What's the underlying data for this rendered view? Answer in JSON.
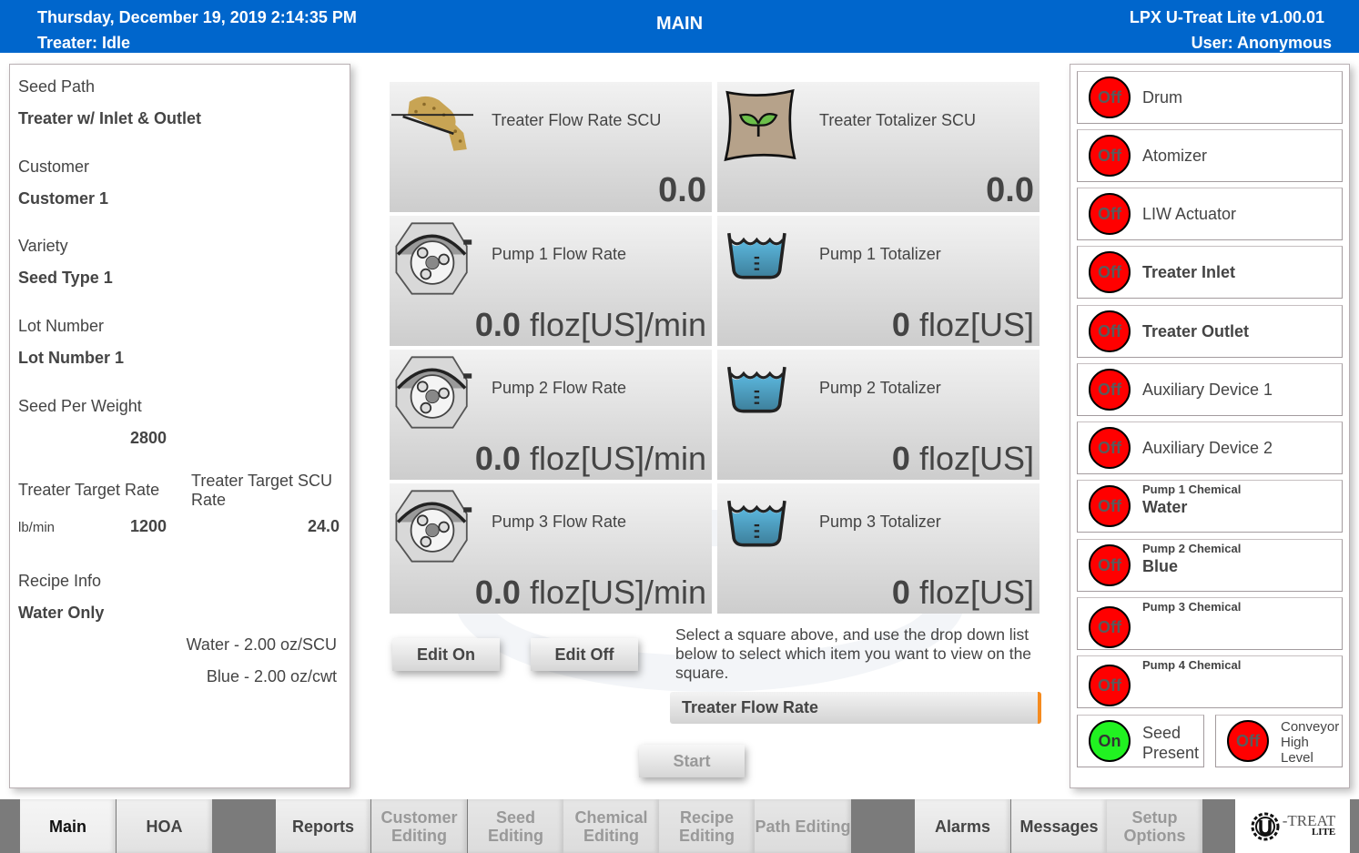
{
  "header": {
    "datetime": "Thursday, December 19, 2019 2:14:35 PM",
    "treater_status": "Treater: Idle",
    "title": "MAIN",
    "app_version": "LPX U-Treat Lite v1.00.01",
    "user": "User: Anonymous"
  },
  "info_panel": {
    "seed_path_label": "Seed Path",
    "seed_path_value": "Treater w/ Inlet & Outlet",
    "customer_label": "Customer",
    "customer_value": "Customer 1",
    "variety_label": "Variety",
    "variety_value": "Seed Type 1",
    "lot_label": "Lot Number",
    "lot_value": "Lot Number 1",
    "seed_per_weight_label": "Seed Per Weight",
    "seed_per_weight_value": "2800",
    "target_rate_label": "Treater Target Rate",
    "target_rate_unit": "lb/min",
    "target_rate_value": "1200",
    "target_scu_label": "Treater Target SCU Rate",
    "target_scu_value": "24.0",
    "recipe_label": "Recipe Info",
    "recipe_value": "Water Only",
    "recipe_lines": [
      "Water - 2.00 oz/SCU",
      "Blue - 2.00 oz/cwt"
    ]
  },
  "tiles": [
    {
      "title": "Treater Flow Rate SCU",
      "value": "0.0",
      "unit": "",
      "icon": "seed-flow-icon"
    },
    {
      "title": "Treater Totalizer SCU",
      "value": "0.0",
      "unit": "",
      "icon": "seed-bag-icon"
    },
    {
      "title": "Pump 1 Flow Rate",
      "value": "0.0",
      "unit": "floz[US]/min",
      "icon": "peristaltic-pump-icon"
    },
    {
      "title": "Pump 1 Totalizer",
      "value": "0",
      "unit": "floz[US]",
      "icon": "water-basin-icon"
    },
    {
      "title": "Pump 2 Flow Rate",
      "value": "0.0",
      "unit": "floz[US]/min",
      "icon": "peristaltic-pump-icon"
    },
    {
      "title": "Pump 2 Totalizer",
      "value": "0",
      "unit": "floz[US]",
      "icon": "water-basin-icon"
    },
    {
      "title": "Pump 3 Flow Rate",
      "value": "0.0",
      "unit": "floz[US]/min",
      "icon": "peristaltic-pump-icon"
    },
    {
      "title": "Pump 3 Totalizer",
      "value": "0",
      "unit": "floz[US]",
      "icon": "water-basin-icon"
    }
  ],
  "controls": {
    "edit_on": "Edit On",
    "edit_off": "Edit Off",
    "instructions": "Select a square above, and use the drop down list below to select which item you want to view on the square.",
    "dropdown_selected": "Treater Flow Rate",
    "start": "Start"
  },
  "devices": [
    {
      "name": "Drum",
      "state": "Off"
    },
    {
      "name": "Atomizer",
      "state": "Off"
    },
    {
      "name": "LIW Actuator",
      "state": "Off"
    },
    {
      "name": "Treater Inlet",
      "state": "Off"
    },
    {
      "name": "Treater Outlet",
      "state": "Off"
    },
    {
      "name": "Auxiliary Device 1",
      "state": "Off"
    },
    {
      "name": "Auxiliary Device 2",
      "state": "Off"
    },
    {
      "label": "Pump 1 Chemical",
      "chemical": "Water",
      "state": "Off"
    },
    {
      "label": "Pump 2 Chemical",
      "chemical": "Blue",
      "state": "Off"
    },
    {
      "label": "Pump 3 Chemical",
      "chemical": "",
      "state": "Off"
    },
    {
      "label": "Pump 4 Chemical",
      "chemical": "",
      "state": "Off"
    },
    {
      "name": "Seed Present",
      "state": "On"
    },
    {
      "name": "Conveyor High Level",
      "state": "Off"
    }
  ],
  "colors": {
    "header_bg": "#0066cc",
    "lamp_off": "#ff0000",
    "lamp_on": "#21f221",
    "dropdown_accent": "#f58b1f"
  },
  "nav": [
    {
      "label": "Main",
      "state": "active"
    },
    {
      "label": "HOA",
      "state": "enabled"
    },
    {
      "label": "Reports",
      "state": "enabled"
    },
    {
      "label": "Customer Editing",
      "state": "disabled"
    },
    {
      "label": "Seed Editing",
      "state": "disabled"
    },
    {
      "label": "Chemical Editing",
      "state": "disabled"
    },
    {
      "label": "Recipe Editing",
      "state": "disabled"
    },
    {
      "label": "Path Editing",
      "state": "disabled"
    },
    {
      "label": "Alarms",
      "state": "enabled"
    },
    {
      "label": "Messages",
      "state": "enabled"
    },
    {
      "label": "Setup Options",
      "state": "disabled"
    }
  ],
  "logo": {
    "brand": "-TREAT",
    "edition": "LITE"
  }
}
